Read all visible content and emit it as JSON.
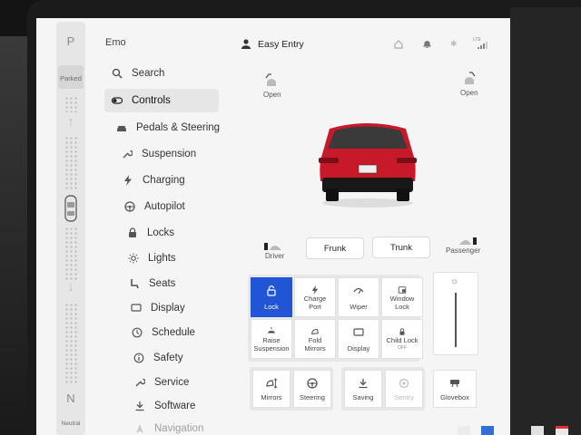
{
  "gear": {
    "p": "P",
    "parked": "Parked",
    "n": "N",
    "neutral": "Neutral"
  },
  "profile": {
    "user": "Emo",
    "mode": "Easy Entry"
  },
  "status": {
    "signal": "LTE"
  },
  "menu": [
    {
      "label": "Search",
      "icon": "search-icon"
    },
    {
      "label": "Controls",
      "icon": "toggle-icon",
      "active": true
    },
    {
      "label": "Pedals & Steering",
      "icon": "car-icon"
    },
    {
      "label": "Suspension",
      "icon": "wrench-icon"
    },
    {
      "label": "Charging",
      "icon": "bolt-icon"
    },
    {
      "label": "Autopilot",
      "icon": "steering-wheel-icon"
    },
    {
      "label": "Locks",
      "icon": "lock-icon"
    },
    {
      "label": "Lights",
      "icon": "sun-icon"
    },
    {
      "label": "Seats",
      "icon": "seat-icon"
    },
    {
      "label": "Display",
      "icon": "display-icon"
    },
    {
      "label": "Schedule",
      "icon": "clock-icon"
    },
    {
      "label": "Safety",
      "icon": "info-icon"
    },
    {
      "label": "Service",
      "icon": "wrench-icon"
    },
    {
      "label": "Software",
      "icon": "download-icon"
    },
    {
      "label": "Navigation",
      "icon": "navigation-icon"
    }
  ],
  "car": {
    "falcon_left": "Open",
    "falcon_right": "Open",
    "driver": "Driver",
    "frunk": "Frunk",
    "trunk": "Trunk",
    "passenger": "Passenger"
  },
  "tiles": [
    {
      "label": "Lock",
      "icon": "unlock-icon",
      "active": true
    },
    {
      "label": "Charge\nPort",
      "icon": "bolt-icon"
    },
    {
      "label": "Wiper",
      "icon": "wiper-icon"
    },
    {
      "label": "Window\nLock",
      "icon": "window-lock-icon"
    },
    {
      "label": "Raise\nSuspension",
      "icon": "suspension-icon"
    },
    {
      "label": "Fold\nMirrors",
      "icon": "mirror-icon"
    },
    {
      "label": "Display",
      "icon": "display-icon"
    },
    {
      "label": "Child Lock",
      "sub": "OFF",
      "icon": "child-lock-icon"
    }
  ],
  "bottom": [
    {
      "label": "Mirrors",
      "icon": "mirror-adjust-icon"
    },
    {
      "label": "Steering",
      "icon": "steering-wheel-icon"
    },
    {
      "label": "Saving",
      "icon": "download-icon"
    },
    {
      "label": "Sentry",
      "icon": "sentry-icon",
      "disabled": true
    },
    {
      "label": "Glovebox",
      "icon": "glovebox-icon"
    }
  ],
  "brightness": {
    "level": 0.0
  }
}
